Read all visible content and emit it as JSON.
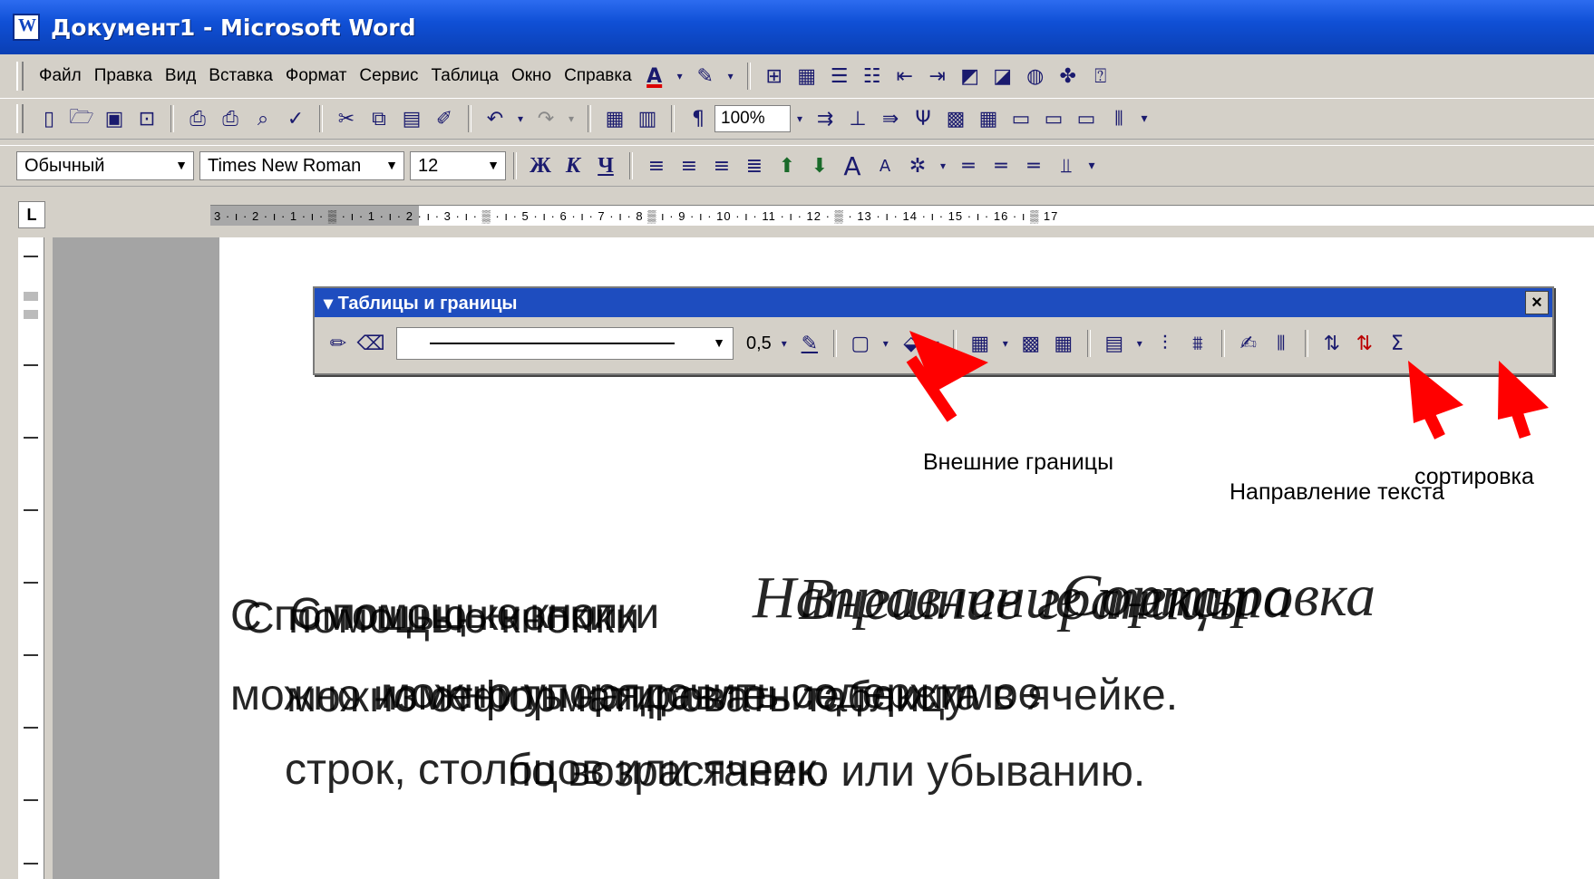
{
  "window": {
    "title": "Документ1 - Microsoft Word"
  },
  "menu": {
    "items": [
      "Файл",
      "Правка",
      "Вид",
      "Вставка",
      "Формат",
      "Сервис",
      "Таблица",
      "Окно",
      "Справка"
    ],
    "icons": [
      "font-color-icon",
      "highlight-icon",
      "table-icon",
      "borders-icon",
      "numbered-list-icon",
      "bullet-list-icon",
      "decrease-indent-icon",
      "increase-indent-icon",
      "web-icon",
      "help-icon"
    ]
  },
  "standard_toolbar": {
    "zoom": "100%"
  },
  "formatting_toolbar": {
    "style": "Обычный",
    "font": "Times New Roman",
    "size": "12",
    "bold": "Ж",
    "italic": "К",
    "underline": "Ч"
  },
  "ruler": {
    "corner": "L",
    "labels": "3 · ı · 2 · ı · 1 · ı · ▒ · ı · 1 · ı · 2 · ı · 3 · ı · ▒ · ı · 5 · ı · 6 · ı · 7 · ı · 8 ▒ ı · 9 · ı · 10 · ı · 11 · ı · 12 · ▒ · 13 · ı · 14 · ı · 15 · ı · 16 · ı ▒ 17"
  },
  "palette": {
    "title": "▾ Таблицы и границы",
    "close": "×",
    "line_weight": "0,5",
    "sum": "Σ"
  },
  "annotations": {
    "outer_borders": "Внешние границы",
    "text_direction": "Направление текста",
    "sorting": "сортировка"
  },
  "body": {
    "layer1_line1": "С помощью кнопки",
    "layer1_line2": "можно изменить направление текста в ячейке.",
    "layer2_line1": "С помощью кнопки",
    "layer2_line2": "можно отформатировать таблицу",
    "layer2_line3": "строк, столбцов или ячеек.",
    "layer3_line1": "С помощью кнопки",
    "layer3_line2": "можно упорядочить содержимое",
    "layer3_line3": "по возрастанию или убыванию.",
    "italic1": "Направление текста",
    "italic2": "Внешние границы",
    "italic3": "Сортировка"
  }
}
